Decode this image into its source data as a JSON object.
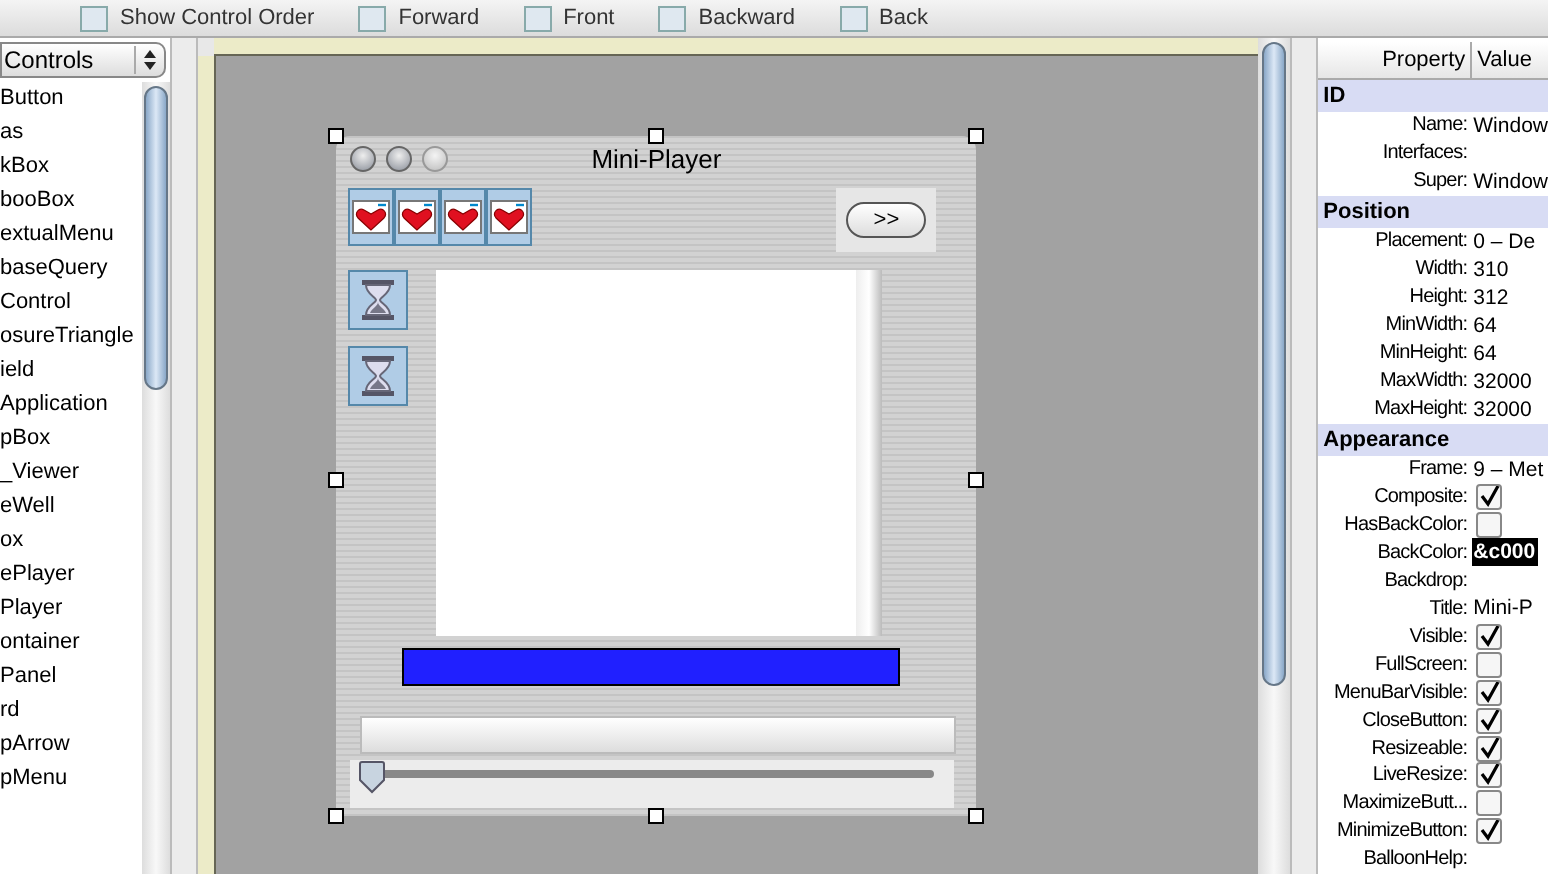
{
  "toolbar": [
    {
      "label": "Show Control Order"
    },
    {
      "label": "Forward"
    },
    {
      "label": "Front"
    },
    {
      "label": "Backward"
    },
    {
      "label": "Back"
    }
  ],
  "controls_panel": {
    "popup": "Controls",
    "items": [
      "Button",
      "as",
      "kBox",
      "booBox",
      "extualMenu",
      "baseQuery",
      "Control",
      "osureTriangle",
      "ield",
      "Application",
      "pBox",
      "_Viewer",
      "eWell",
      "ox",
      "ePlayer",
      "Player",
      "ontainer",
      "Panel",
      "rd",
      "pArrow",
      "pMenu"
    ]
  },
  "window": {
    "title": "Mini-Player",
    "next_button": ">>",
    "slider": {
      "level": 0
    }
  },
  "properties": {
    "columns": [
      "Property",
      "Value"
    ],
    "rows": [
      {
        "kind": "header",
        "label": "ID"
      },
      {
        "kind": "text",
        "label": "Name:",
        "value": "Window",
        "selected": false
      },
      {
        "kind": "text",
        "label": "Interfaces:"
      },
      {
        "kind": "text",
        "label": "Super:",
        "value": "Window",
        "selected": false
      },
      {
        "kind": "header",
        "label": "Position"
      },
      {
        "kind": "text",
        "label": "Placement:",
        "value": "0 – De",
        "selected": false
      },
      {
        "kind": "text",
        "label": "Width:",
        "value": "310",
        "selected": false
      },
      {
        "kind": "text",
        "label": "Height:",
        "value": "312",
        "selected": false
      },
      {
        "kind": "text",
        "label": "MinWidth:",
        "value": "64",
        "selected": false
      },
      {
        "kind": "text",
        "label": "MinHeight:",
        "value": "64",
        "selected": false
      },
      {
        "kind": "text",
        "label": "MaxWidth:",
        "value": "32000",
        "selected": false
      },
      {
        "kind": "text",
        "label": "MaxHeight:",
        "value": "32000",
        "selected": false
      },
      {
        "kind": "header",
        "label": "Appearance"
      },
      {
        "kind": "text",
        "label": "Frame:",
        "value": "9 – Met",
        "selected": false
      },
      {
        "kind": "checkbox",
        "label": "Composite:",
        "checked": true
      },
      {
        "kind": "checkbox",
        "label": "HasBackColor:",
        "checked": false
      },
      {
        "kind": "text",
        "label": "BackColor:",
        "value": "&c000",
        "selected": true
      },
      {
        "kind": "text",
        "label": "Backdrop:"
      },
      {
        "kind": "text",
        "label": "Title:",
        "value": "Mini-P",
        "selected": false
      },
      {
        "kind": "checkbox",
        "label": "Visible:",
        "checked": true
      },
      {
        "kind": "checkbox",
        "label": "FullScreen:",
        "checked": false
      },
      {
        "kind": "checkbox",
        "label": "MenuBarVisible:",
        "checked": true
      },
      {
        "kind": "checkbox",
        "label": "CloseButton:",
        "checked": true
      },
      {
        "kind": "checkbox",
        "label": "Resizeable:",
        "checked": true
      },
      {
        "kind": "checkbox",
        "label": "LiveResize:",
        "checked": true
      },
      {
        "kind": "checkbox",
        "label": "MaximizeButt...",
        "checked": false
      },
      {
        "kind": "checkbox",
        "label": "MinimizeButton:",
        "checked": true
      },
      {
        "kind": "text",
        "label": "BalloonHelp:"
      }
    ]
  }
}
